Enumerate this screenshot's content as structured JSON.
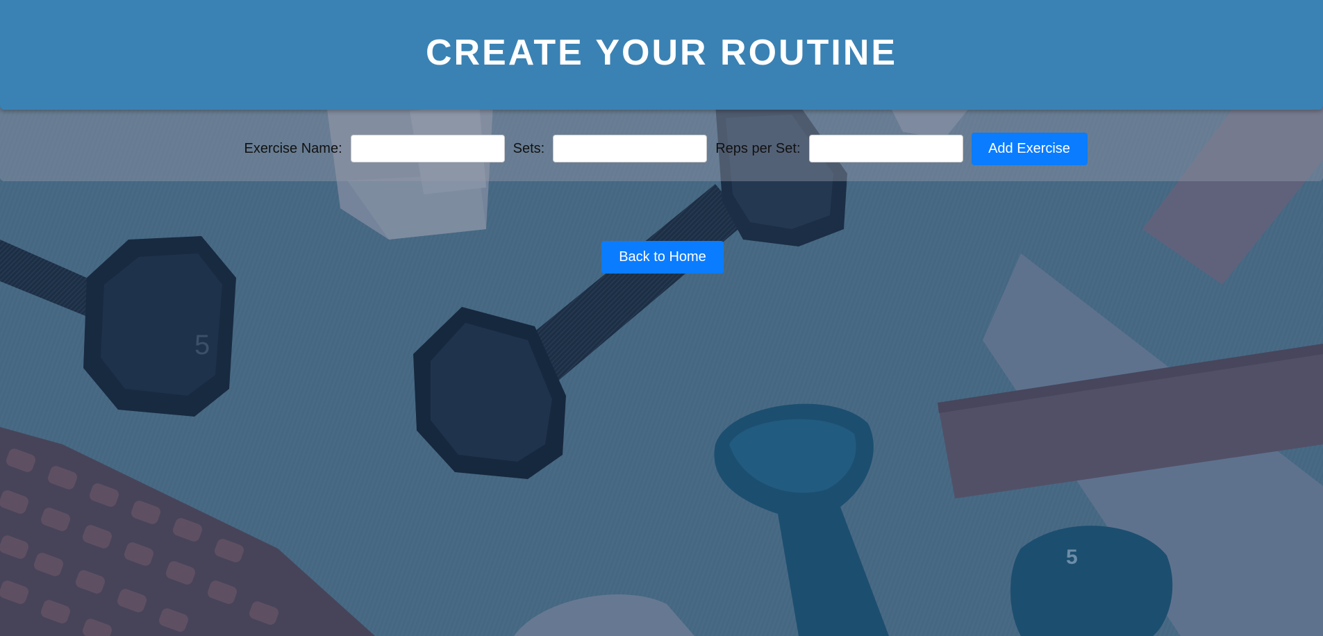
{
  "header": {
    "title": "CREATE YOUR ROUTINE"
  },
  "form": {
    "exercise_name_label": "Exercise Name:",
    "exercise_name_value": "",
    "sets_label": "Sets:",
    "sets_value": "",
    "reps_label": "Reps per Set:",
    "reps_value": "",
    "add_button_label": "Add Exercise"
  },
  "navigation": {
    "back_button_label": "Back to Home"
  },
  "background": {
    "dumbbell_left_number": "5",
    "dumbbell_right_number": "5"
  },
  "colors": {
    "header": "#3a82b4",
    "button": "#0a7cff",
    "mat": "#5f8198"
  }
}
